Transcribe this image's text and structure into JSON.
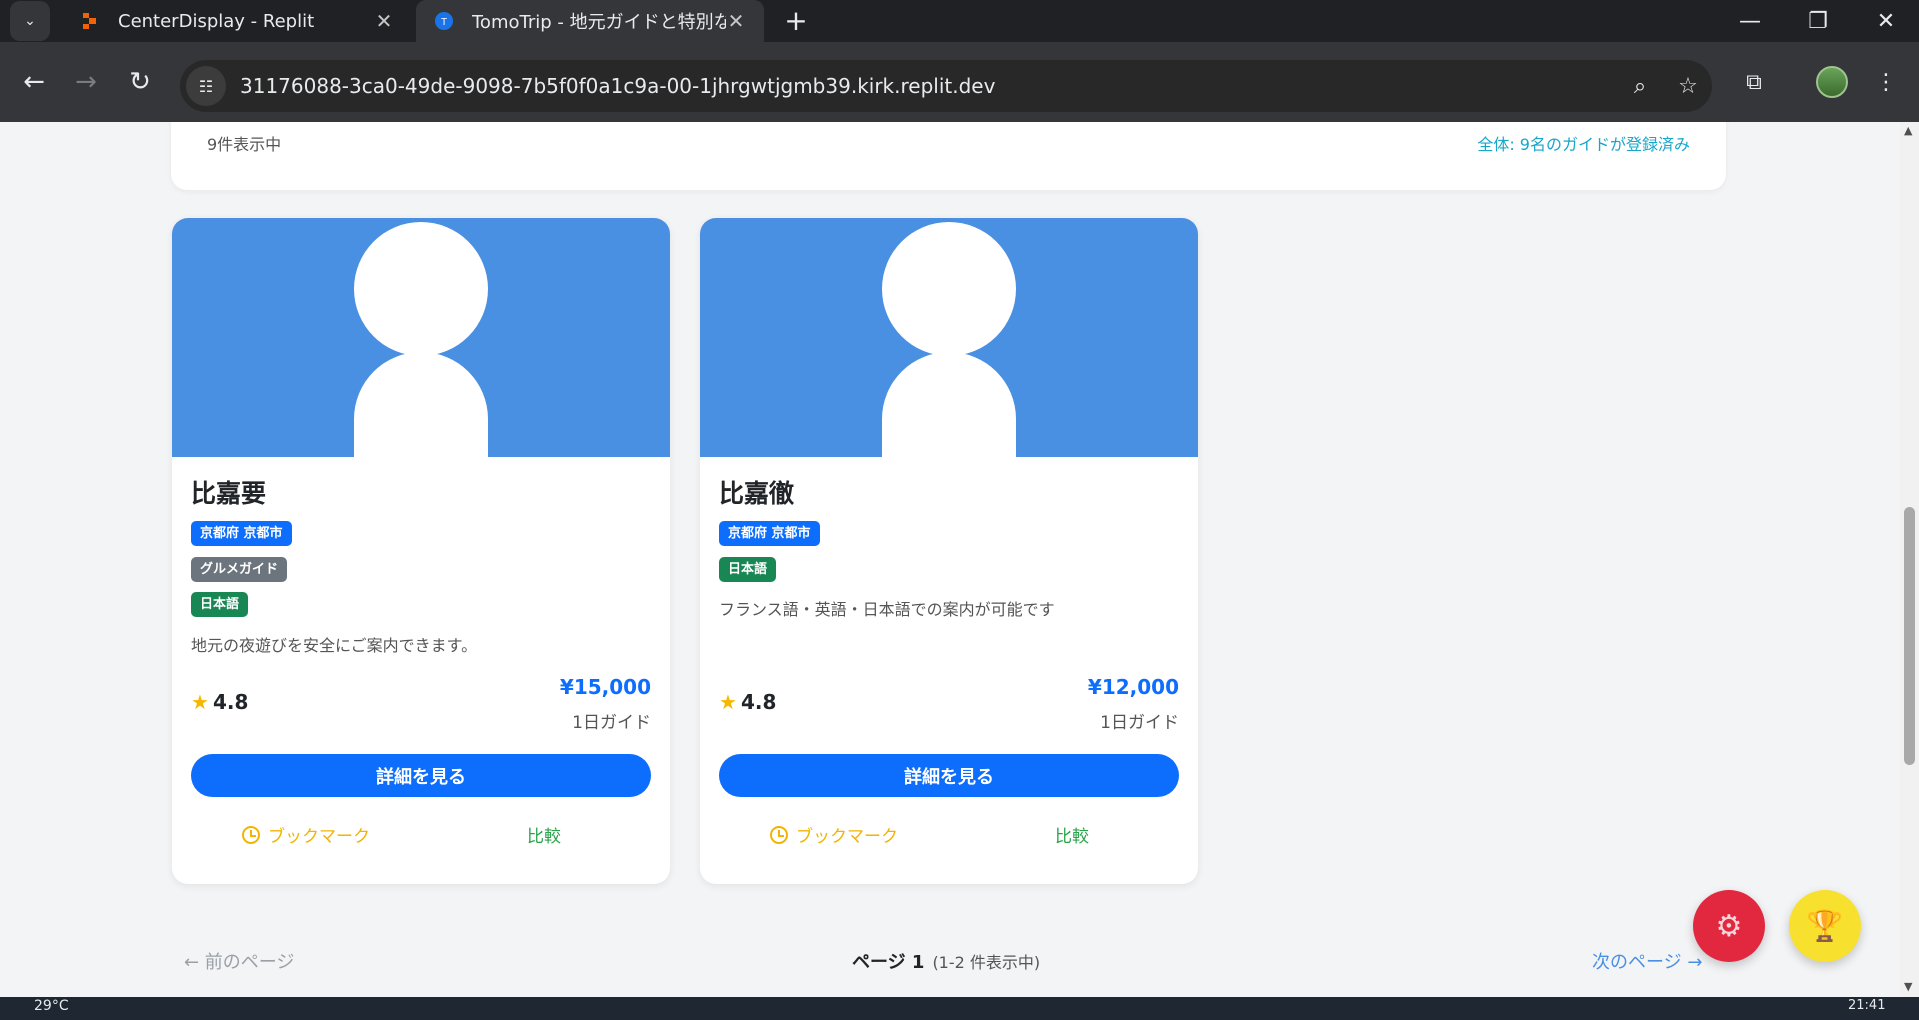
{
  "browser": {
    "tabs": [
      {
        "title": "CenterDisplay - Replit",
        "close_glyph": "✕"
      },
      {
        "title": "TomoTrip - 地元ガイドと特別な旅",
        "close_glyph": "✕",
        "favicon_letter": "T"
      }
    ],
    "new_tab_glyph": "+",
    "url": "31176088-3ca0-49de-9098-7b5f0f0a1c9a-00-1jhrgwtjgmb39.kirk.replit.dev",
    "accent_colors": {
      "replit": "#f26207",
      "tomotrip": "#1a73e8"
    }
  },
  "summary": {
    "showing": "9件表示中",
    "total": "全体: 9名のガイドが登録済み"
  },
  "guides": [
    {
      "name": "比嘉要",
      "location": "京都府 京都市",
      "specialty": "グルメガイド",
      "language": "日本語",
      "description": "地元の夜遊びを安全にご案内できます。",
      "rating": "4.8",
      "price": "¥15,000",
      "price_unit": "1日ガイド",
      "detail_label": "詳細を見る",
      "bookmark_label": "ブックマーク",
      "compare_label": "比較"
    },
    {
      "name": "比嘉徹",
      "location": "京都府 京都市",
      "language": "日本語",
      "description": "フランス語・英語・日本語での案内が可能です",
      "rating": "4.8",
      "price": "¥12,000",
      "price_unit": "1日ガイド",
      "detail_label": "詳細を見る",
      "bookmark_label": "ブックマーク",
      "compare_label": "比較"
    }
  ],
  "pagination": {
    "prev": "← 前のページ",
    "page_label": "ページ 1",
    "count": "(1-2 件表示中)",
    "next": "次のページ →"
  },
  "fabs": {
    "settings_icon": "gear-icon",
    "trophy_icon": "trophy-icon"
  },
  "colors": {
    "primary": "#0d6efd",
    "photo_bg": "#4a90e2",
    "bookmark": "#f2b400",
    "compare": "#2aa44a",
    "fab_settings": "#e2283f",
    "fab_trophy": "#f7e12e"
  },
  "taskbar": {
    "temperature": "29°C",
    "time": "21:41"
  }
}
